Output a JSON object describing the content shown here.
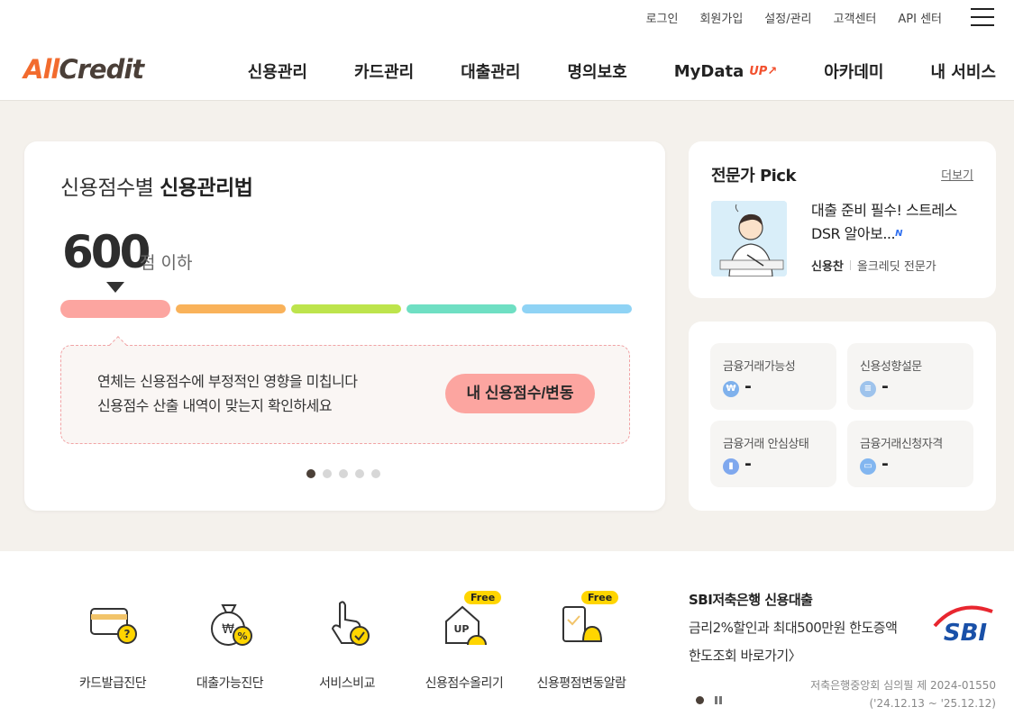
{
  "header": {
    "util_links": [
      "로그인",
      "회원가입",
      "설정/관리",
      "고객센터",
      "API 센터"
    ],
    "logo_part1": "All",
    "logo_part2": "Credit",
    "nav": [
      "신용관리",
      "카드관리",
      "대출관리",
      "명의보호",
      "MyData",
      "아카데미",
      "내 서비스"
    ],
    "mydata_badge": "UP"
  },
  "score_card": {
    "title_light": "신용점수별 ",
    "title_bold": "신용관리법",
    "score": "600",
    "score_suffix": "점 이하",
    "bar_colors": [
      "#fca5a0",
      "#f9b25a",
      "#bde44c",
      "#6fdfc3",
      "#8fd3f5"
    ],
    "active_bar_index": 0,
    "message_line1": "연체는 신용점수에 부정적인 영향을 미칩니다",
    "message_line2": "신용점수 산출 내역이 맞는지 확인하세요",
    "button": "내 신용점수/변동",
    "slide_count": 5,
    "active_slide": 0
  },
  "expert_pick": {
    "title": "전문가 Pick",
    "more": "더보기",
    "headline": "대출 준비 필수! 스트레스 DSR 알아보...",
    "new_badge": "N",
    "author": "신용찬",
    "author_role": "올크레딧 전문가"
  },
  "info_tiles": [
    {
      "label": "금융거래가능성",
      "value": "-",
      "icon": "won-icon",
      "color": "#7fb1ec"
    },
    {
      "label": "신용성향설문",
      "value": "-",
      "icon": "document-icon",
      "color": "#9ec3ec"
    },
    {
      "label": "금융거래 안심상태",
      "value": "-",
      "icon": "bar-chart-icon",
      "color": "#7fa8ee"
    },
    {
      "label": "금융거래신청자격",
      "value": "-",
      "icon": "id-card-icon",
      "color": "#82b6f0"
    }
  ],
  "services": [
    {
      "label": "카드발급진단",
      "icon": "card-question-icon",
      "free": false
    },
    {
      "label": "대출가능진단",
      "icon": "money-bag-icon",
      "free": false
    },
    {
      "label": "서비스비교",
      "icon": "hand-check-icon",
      "free": false
    },
    {
      "label": "신용점수올리기",
      "icon": "house-up-icon",
      "free": true
    },
    {
      "label": "신용평점변동알람",
      "icon": "phone-bell-icon",
      "free": true
    }
  ],
  "free_badge": "Free",
  "ad": {
    "title": "SBI저축은행 신용대출",
    "line1": "금리2%할인과 최대500만원 한도증액",
    "line2": "한도조회 바로가기〉",
    "brand": "SBI",
    "meta_line1": "저축은행중앙회 심의필 제 2024-01550",
    "meta_line2": "('24.12.13 ~ '25.12.12)"
  }
}
